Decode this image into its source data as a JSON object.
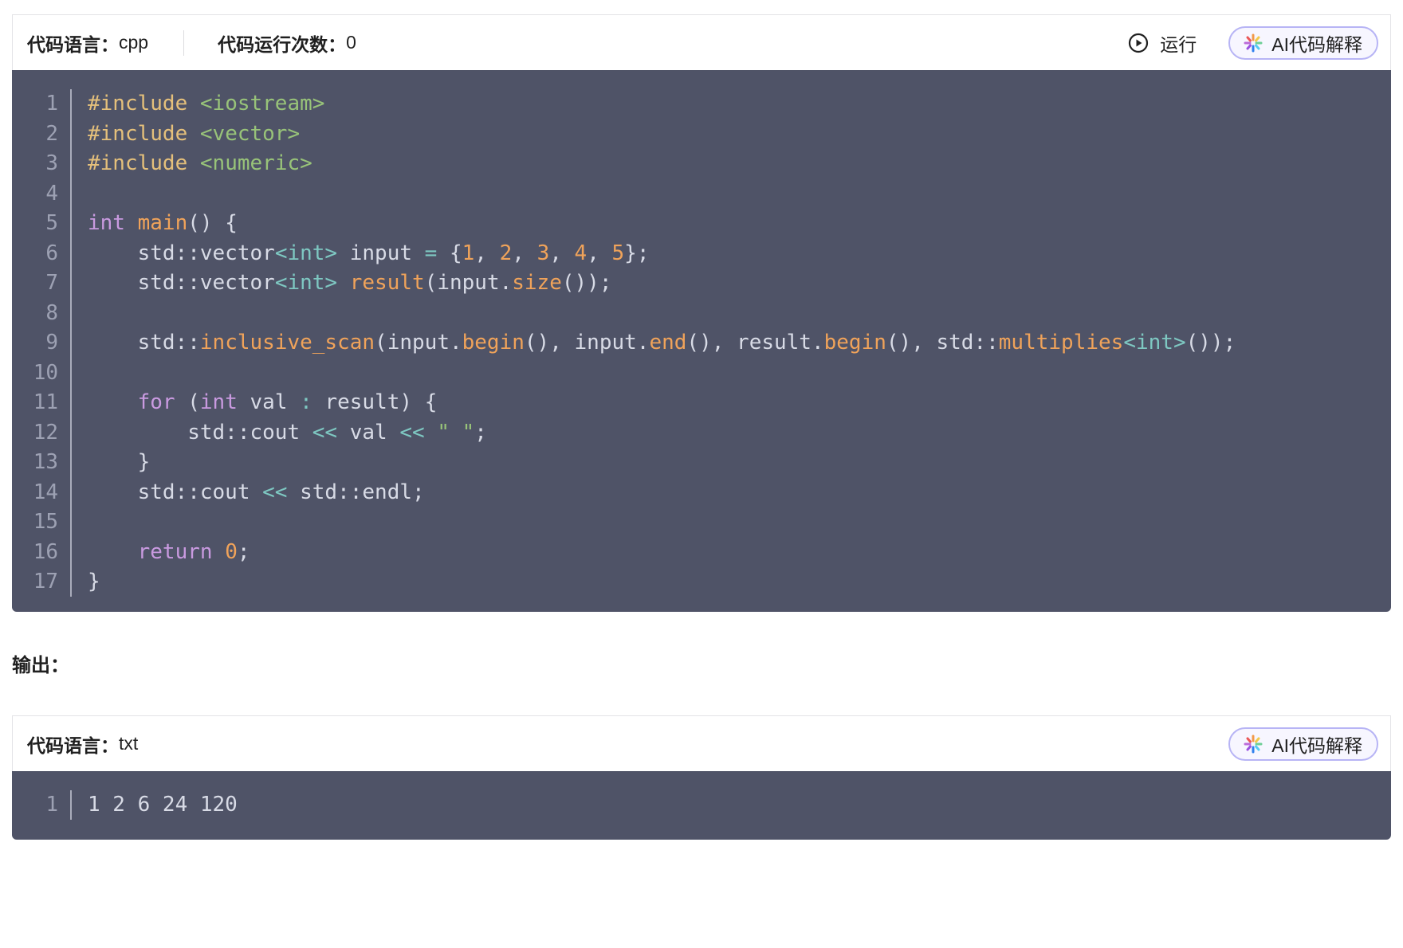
{
  "block1": {
    "language_label": "代码语言：",
    "language_value": "cpp",
    "run_count_label": "代码运行次数：",
    "run_count_value": "0",
    "run_label": "运行",
    "ai_label": "AI代码解释",
    "lines": [
      [
        [
          "#include",
          "#e5c07b"
        ],
        [
          " ",
          "#d8dbe6"
        ],
        [
          "<iostream>",
          "#98c379"
        ]
      ],
      [
        [
          "#include",
          "#e5c07b"
        ],
        [
          " ",
          "#d8dbe6"
        ],
        [
          "<vector>",
          "#98c379"
        ]
      ],
      [
        [
          "#include",
          "#e5c07b"
        ],
        [
          " ",
          "#d8dbe6"
        ],
        [
          "<numeric>",
          "#98c379"
        ]
      ],
      [],
      [
        [
          "int",
          "#c99ae0"
        ],
        [
          " ",
          "#d8dbe6"
        ],
        [
          "main",
          "#f0a35a"
        ],
        [
          "() {",
          "#d8dbe6"
        ]
      ],
      [
        [
          "    std::vector",
          "#d8dbe6"
        ],
        [
          "<int>",
          "#7ec8c2"
        ],
        [
          " input ",
          "#d8dbe6"
        ],
        [
          "=",
          "#7ec8c2"
        ],
        [
          " {",
          "#d8dbe6"
        ],
        [
          "1",
          "#f0a35a"
        ],
        [
          ", ",
          "#d8dbe6"
        ],
        [
          "2",
          "#f0a35a"
        ],
        [
          ", ",
          "#d8dbe6"
        ],
        [
          "3",
          "#f0a35a"
        ],
        [
          ", ",
          "#d8dbe6"
        ],
        [
          "4",
          "#f0a35a"
        ],
        [
          ", ",
          "#d8dbe6"
        ],
        [
          "5",
          "#f0a35a"
        ],
        [
          "};",
          "#d8dbe6"
        ]
      ],
      [
        [
          "    std::vector",
          "#d8dbe6"
        ],
        [
          "<int>",
          "#7ec8c2"
        ],
        [
          " ",
          "#d8dbe6"
        ],
        [
          "result",
          "#f0a35a"
        ],
        [
          "(input.",
          "#d8dbe6"
        ],
        [
          "size",
          "#f0a35a"
        ],
        [
          "());",
          "#d8dbe6"
        ]
      ],
      [],
      [
        [
          "    std::",
          "#d8dbe6"
        ],
        [
          "inclusive_scan",
          "#f0a35a"
        ],
        [
          "(input.",
          "#d8dbe6"
        ],
        [
          "begin",
          "#f0a35a"
        ],
        [
          "(), input.",
          "#d8dbe6"
        ],
        [
          "end",
          "#f0a35a"
        ],
        [
          "(), result.",
          "#d8dbe6"
        ],
        [
          "begin",
          "#f0a35a"
        ],
        [
          "(), std::",
          "#d8dbe6"
        ],
        [
          "multiplies",
          "#f0a35a"
        ],
        [
          "<int>",
          "#7ec8c2"
        ],
        [
          "());",
          "#d8dbe6"
        ]
      ],
      [],
      [
        [
          "    ",
          "#d8dbe6"
        ],
        [
          "for",
          "#c99ae0"
        ],
        [
          " (",
          "#d8dbe6"
        ],
        [
          "int",
          "#c99ae0"
        ],
        [
          " val ",
          "#d8dbe6"
        ],
        [
          ":",
          "#7ec8c2"
        ],
        [
          " result) {",
          "#d8dbe6"
        ]
      ],
      [
        [
          "        std::cout ",
          "#d8dbe6"
        ],
        [
          "<<",
          "#7ec8c2"
        ],
        [
          " val ",
          "#d8dbe6"
        ],
        [
          "<<",
          "#7ec8c2"
        ],
        [
          " ",
          "#d8dbe6"
        ],
        [
          "\" \"",
          "#98c379"
        ],
        [
          ";",
          "#d8dbe6"
        ]
      ],
      [
        [
          "    }",
          "#d8dbe6"
        ]
      ],
      [
        [
          "    std::cout ",
          "#d8dbe6"
        ],
        [
          "<<",
          "#7ec8c2"
        ],
        [
          " std::endl;",
          "#d8dbe6"
        ]
      ],
      [],
      [
        [
          "    ",
          "#d8dbe6"
        ],
        [
          "return",
          "#c99ae0"
        ],
        [
          " ",
          "#d8dbe6"
        ],
        [
          "0",
          "#f0a35a"
        ],
        [
          ";",
          "#d8dbe6"
        ]
      ],
      [
        [
          "}",
          "#d8dbe6"
        ]
      ]
    ]
  },
  "output_label": "输出：",
  "block2": {
    "language_label": "代码语言：",
    "language_value": "txt",
    "ai_label": "AI代码解释",
    "lines": [
      [
        [
          "1 2 6 24 120",
          "#d8dbe6"
        ]
      ]
    ]
  },
  "colors": {
    "code_bg": "#4f5367",
    "line_number": "#9da1b3",
    "default_text": "#d8dbe6",
    "keyword": "#c99ae0",
    "preprocessor": "#e5c07b",
    "string_include": "#98c379",
    "function_number": "#f0a35a",
    "operator": "#7ec8c2",
    "ai_button_border": "#b7b4f5"
  }
}
